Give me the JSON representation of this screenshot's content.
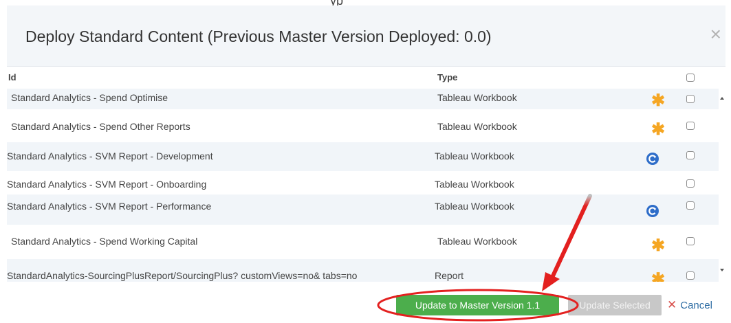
{
  "page_top_text": "yp",
  "dialog": {
    "title": "Deploy Standard Content (Previous Master Version Deployed: 0.0)",
    "close_glyph": "×"
  },
  "table": {
    "columns": {
      "id": "Id",
      "type": "Type"
    },
    "rows": [
      {
        "id": "Standard Analytics - Spend Optimise",
        "type": "Tableau Workbook",
        "status_icon": "asterisk-icon"
      },
      {
        "id": "Standard Analytics - Spend Other Reports",
        "type": "Tableau Workbook",
        "status_icon": "asterisk-icon"
      },
      {
        "id": "Standard Analytics - SVM Report - Development",
        "type": "Tableau Workbook",
        "status_icon": "refresh-icon"
      },
      {
        "id": "Standard Analytics - SVM Report - Onboarding",
        "type": "Tableau Workbook",
        "status_icon": ""
      },
      {
        "id": "Standard Analytics - SVM Report - Performance",
        "type": "Tableau Workbook",
        "status_icon": "refresh-icon"
      },
      {
        "id": "Standard Analytics - Spend Working Capital",
        "type": "Tableau Workbook",
        "status_icon": "asterisk-icon"
      },
      {
        "id": "StandardAnalytics-SourcingPlusReport/SourcingPlus? customViews=no& tabs=no",
        "type": "Report",
        "status_icon": "asterisk-icon"
      }
    ]
  },
  "footer": {
    "update_master_label": "Update to Master Version 1.1",
    "update_selected_label": "Update Selected",
    "cancel_glyph": "✕",
    "cancel_label": "Cancel"
  },
  "colors": {
    "accent_green": "#4cae4c",
    "asterisk_orange": "#f5a623",
    "refresh_blue": "#2e6dc9",
    "annotation_red": "#e3201f"
  }
}
